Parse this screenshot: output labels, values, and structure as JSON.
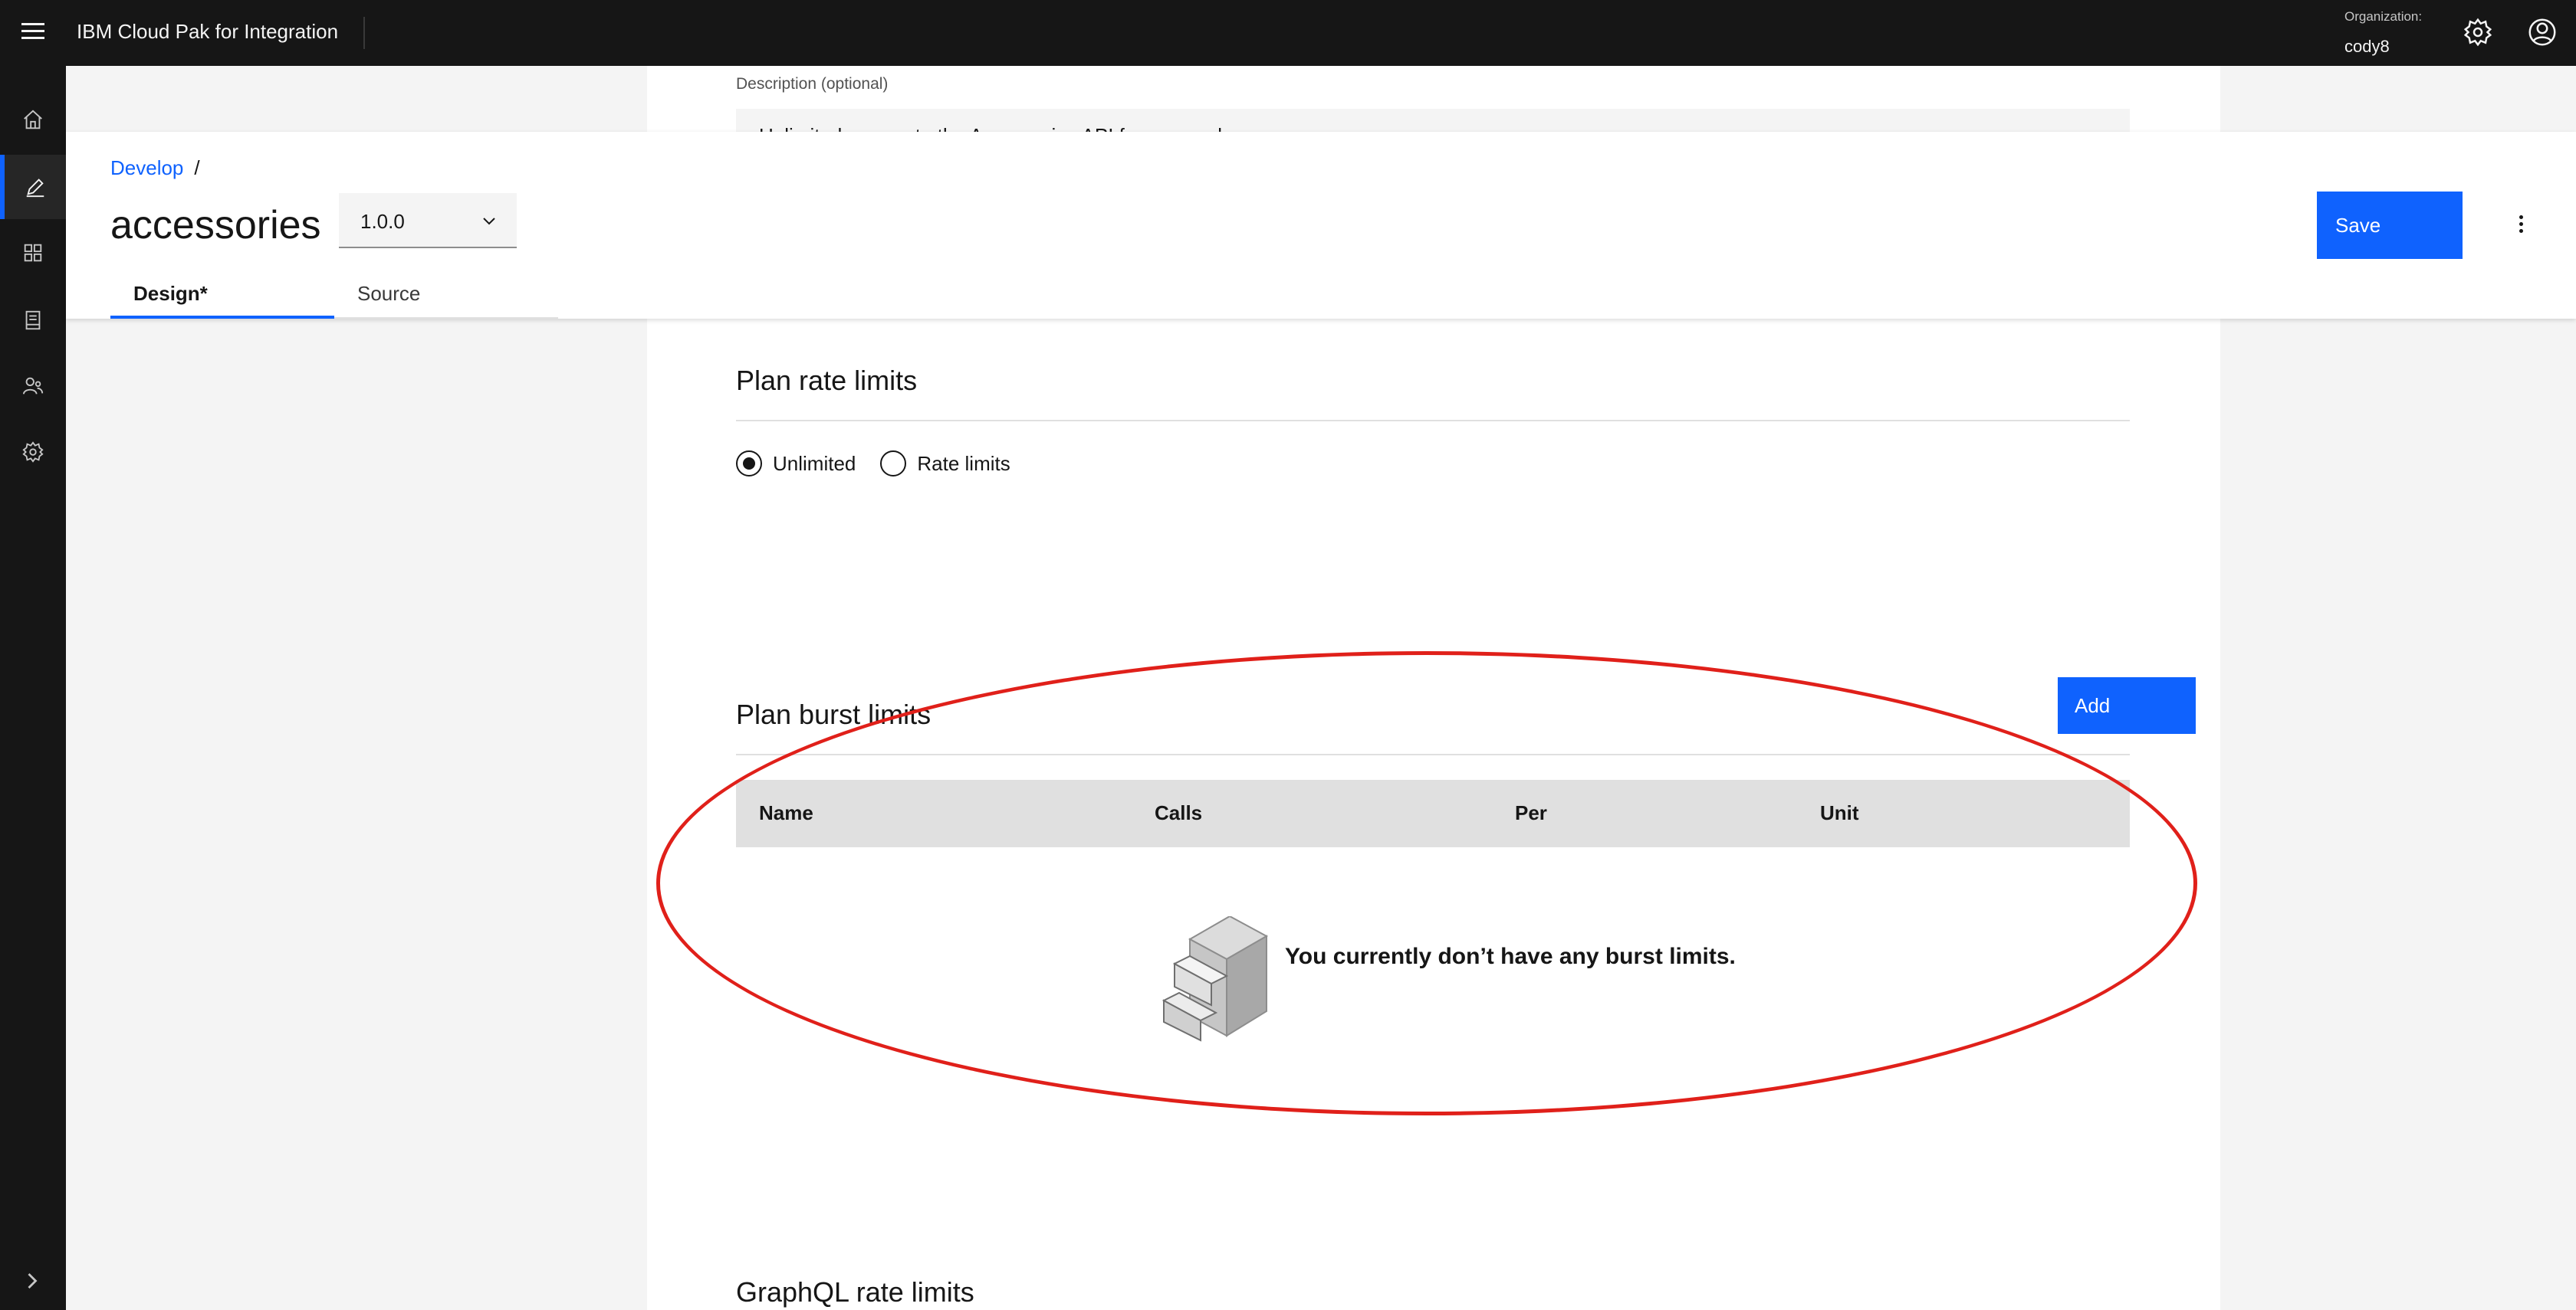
{
  "header": {
    "app_title": "IBM Cloud Pak for Integration",
    "org_label": "Organization:",
    "org_name": "cody8",
    "icons": [
      "hamburger-menu-icon",
      "settings-icon",
      "user-avatar-icon"
    ]
  },
  "siderail": {
    "items": [
      {
        "icon": "home-icon",
        "active": false
      },
      {
        "icon": "edit-icon",
        "active": true
      },
      {
        "icon": "apps-icon",
        "active": false
      },
      {
        "icon": "document-icon",
        "active": false
      },
      {
        "icon": "users-icon",
        "active": false
      },
      {
        "icon": "settings-icon",
        "active": false
      }
    ],
    "expand_icon": "chevron-right-icon"
  },
  "page_header": {
    "breadcrumb": [
      {
        "label": "Develop",
        "separator": "/"
      }
    ],
    "title": "accessories",
    "version": "1.0.0",
    "tabs": [
      {
        "label": "Design*",
        "selected": true
      },
      {
        "label": "Source",
        "selected": false
      }
    ],
    "save_label": "Save"
  },
  "form": {
    "description_label": "Description (optional)",
    "description_value": "Unlimited access to the Accessories API for your web app",
    "rate_limits": {
      "title": "Plan rate limits",
      "options": [
        {
          "label": "Unlimited",
          "selected": true
        },
        {
          "label": "Rate limits",
          "selected": false
        }
      ]
    },
    "burst_limits": {
      "title": "Plan burst limits",
      "add_label": "Add",
      "columns": [
        "Name",
        "Calls",
        "Per",
        "Unit"
      ],
      "empty_text": "You currently don’t have any burst limits."
    },
    "graphql_title": "GraphQL rate limits"
  },
  "colors": {
    "accent": "#0f62fe",
    "header_bg": "#161616",
    "annotation": "#e0201a"
  }
}
